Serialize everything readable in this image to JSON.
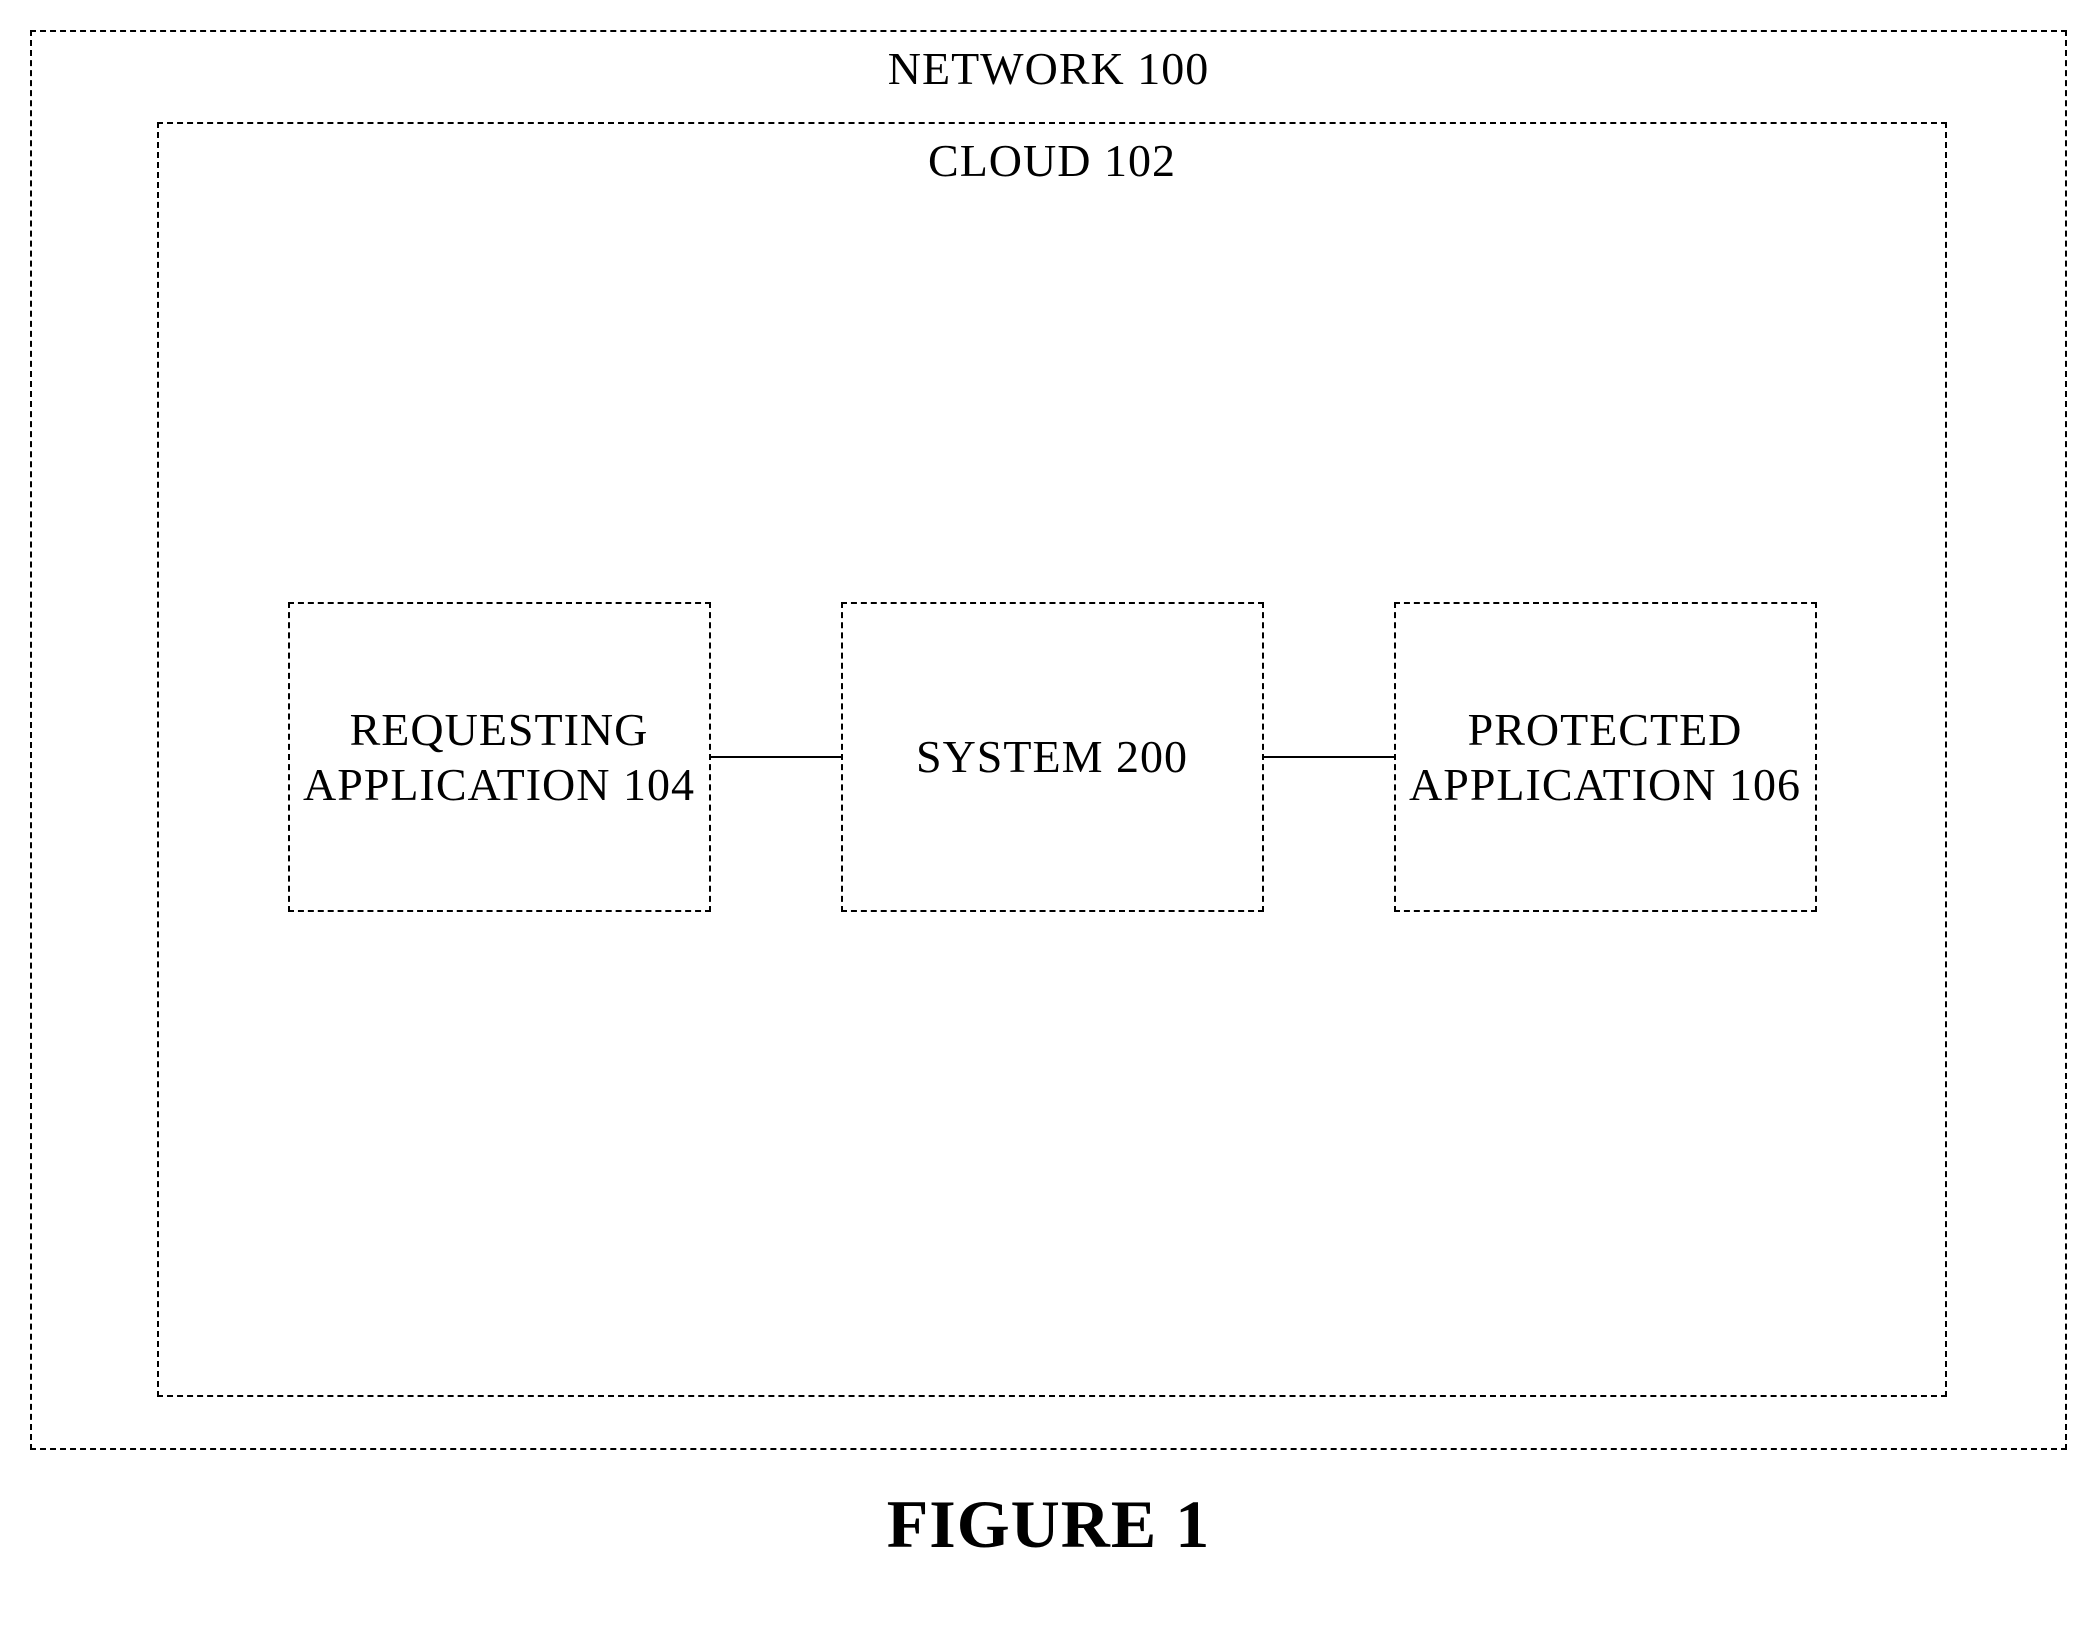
{
  "diagram": {
    "network": {
      "label": "NETWORK 100"
    },
    "cloud": {
      "label": "CLOUD 102"
    },
    "boxes": {
      "requesting": {
        "line1": "REQUESTING",
        "line2": "APPLICATION 104"
      },
      "system": {
        "label": "SYSTEM 200"
      },
      "protected": {
        "line1": "PROTECTED",
        "line2": "APPLICATION 106"
      }
    },
    "caption": "FIGURE 1"
  }
}
